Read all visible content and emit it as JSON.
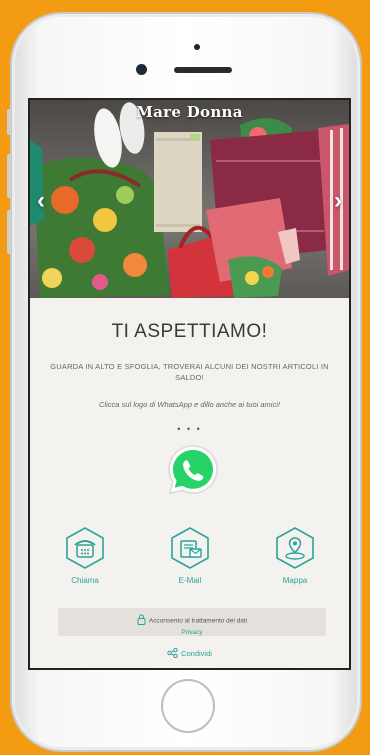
{
  "hero": {
    "title": "Mare Donna",
    "prev_icon": "chevron-left-icon",
    "next_icon": "chevron-right-icon"
  },
  "main": {
    "headline": "TI ASPETTIAMO!",
    "subtitle": "GUARDA IN ALTO E SFOGLIA, TROVERAI ALCUNI DEI NOSTRI ARTICOLI IN SALDO!",
    "cta": "Clicca sul logo di WhatsApp e dillo anche ai tuoi amici!",
    "dots": "• • •",
    "whatsapp_icon": "whatsapp-icon"
  },
  "actions": [
    {
      "label": "Chiama",
      "icon": "phone-icon"
    },
    {
      "label": "E-Mail",
      "icon": "email-icon"
    },
    {
      "label": "Mappa",
      "icon": "map-pin-icon"
    }
  ],
  "privacy": {
    "text": "Acconsento al trattamento dei dati",
    "link": "Privacy"
  },
  "share": {
    "label": "Condividi"
  },
  "colors": {
    "accent": "#2ba39a",
    "frame_bg": "#f39c12",
    "whatsapp": "#25d366"
  }
}
